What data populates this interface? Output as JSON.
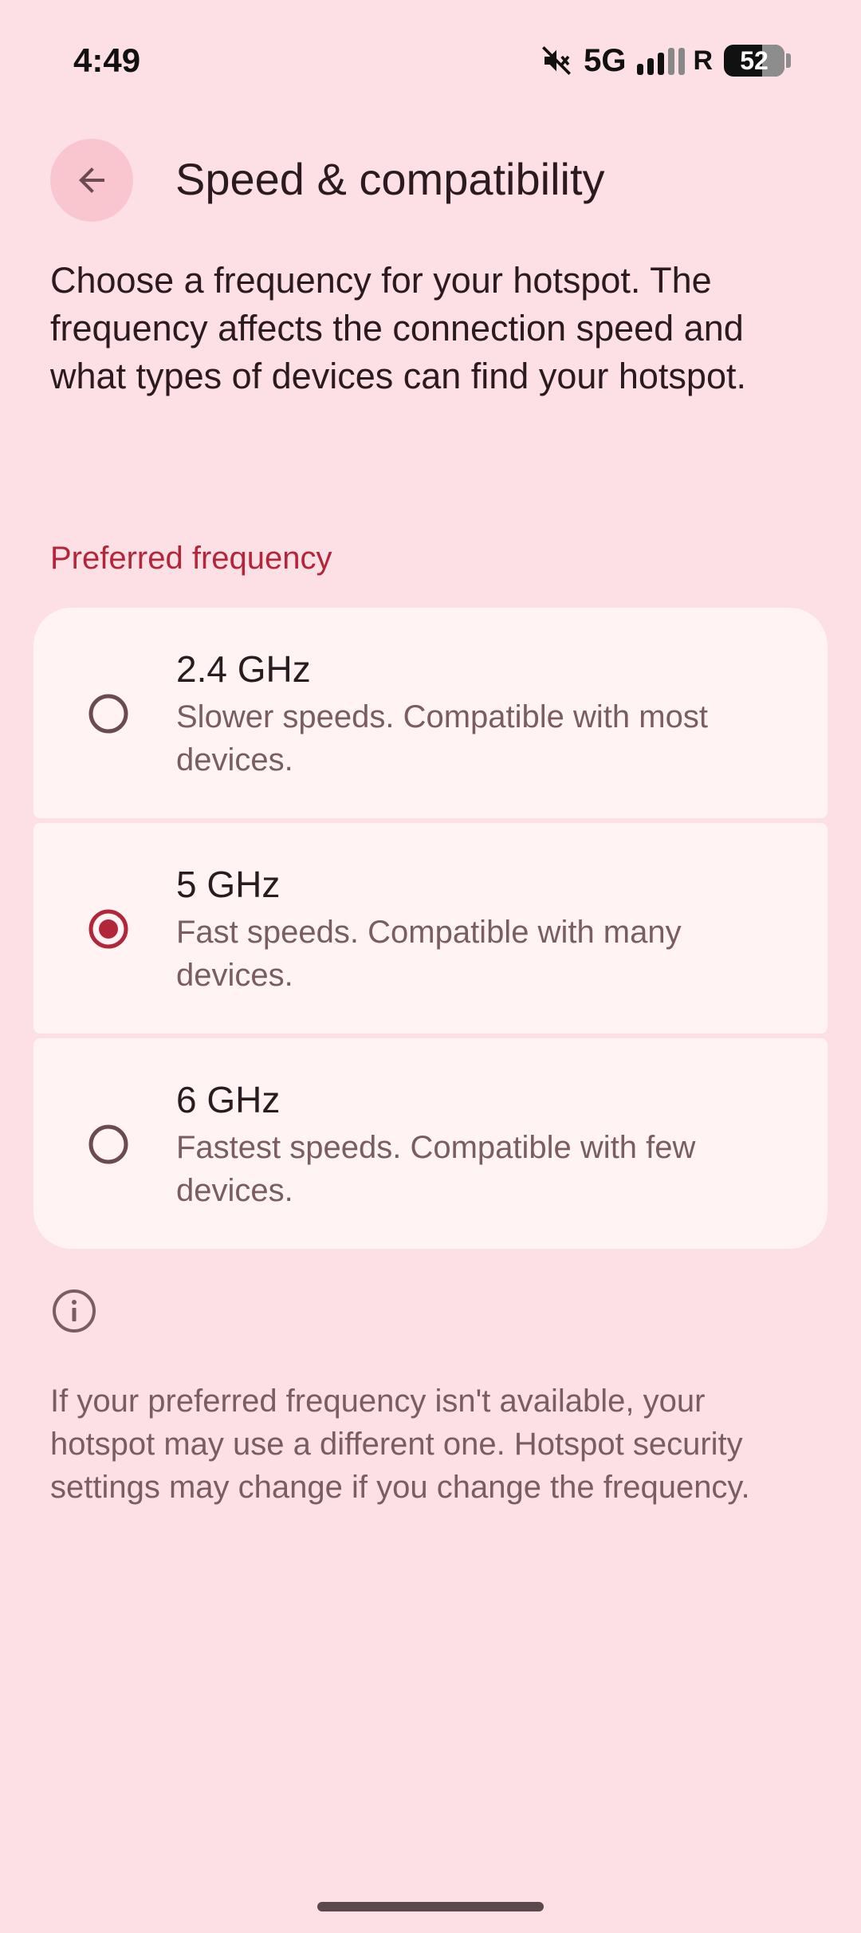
{
  "status_bar": {
    "time": "4:49",
    "network": "5G",
    "roaming": "R",
    "battery": "52",
    "icons": [
      "mute-icon",
      "signal-icon"
    ]
  },
  "app_bar": {
    "title": "Speed & compatibility",
    "back_icon": "arrow-back-icon"
  },
  "intro": "Choose a frequency for your hotspot. The frequency affects the connection speed and what types of devices can find your hotspot.",
  "section_header": "Preferred frequency",
  "options": [
    {
      "title": "2.4 GHz",
      "description": "Slower speeds. Compatible with most devices.",
      "selected": false
    },
    {
      "title": "5 GHz",
      "description": "Fast speeds. Compatible with many devices.",
      "selected": true
    },
    {
      "title": "6 GHz",
      "description": "Fastest speeds. Compatible with few devices.",
      "selected": false
    }
  ],
  "footer": {
    "icon": "info-icon",
    "text": "If your preferred frequency isn't available, your hotspot may use a different one. Hotspot security settings may change if you change the frequency."
  },
  "colors": {
    "background": "#fde0e5",
    "card": "#fff3f4",
    "accent": "#b3263a",
    "back_button_bg": "#f9c6d0"
  }
}
